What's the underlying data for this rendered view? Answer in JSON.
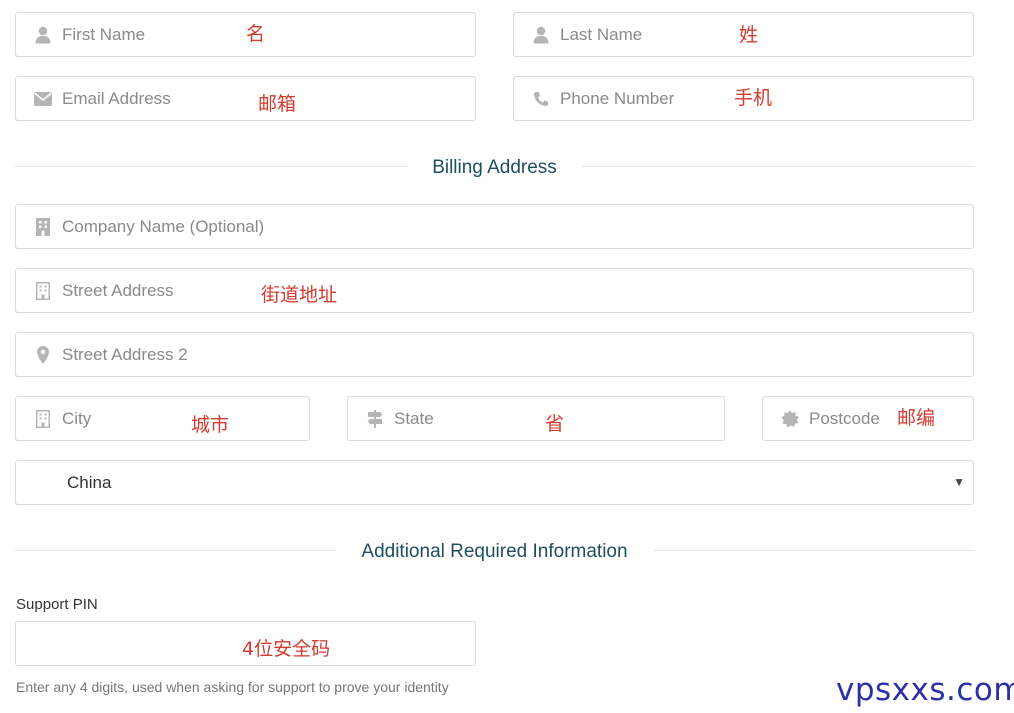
{
  "contact": {
    "first_name": {
      "placeholder": "First Name",
      "note": "名"
    },
    "last_name": {
      "placeholder": "Last Name",
      "note": "姓"
    },
    "email": {
      "placeholder": "Email Address",
      "note": "邮箱"
    },
    "phone": {
      "placeholder": "Phone Number",
      "note": "手机"
    }
  },
  "billing": {
    "title": "Billing Address",
    "company": {
      "placeholder": "Company Name (Optional)"
    },
    "street": {
      "placeholder": "Street Address",
      "note": "街道地址"
    },
    "street2": {
      "placeholder": "Street Address 2"
    },
    "city": {
      "placeholder": "City",
      "note": "城市"
    },
    "state": {
      "placeholder": "State",
      "note": "省"
    },
    "postcode": {
      "placeholder": "Postcode",
      "note": "邮编"
    },
    "country": {
      "value": "China"
    }
  },
  "additional": {
    "title": "Additional Required Information",
    "support_pin_label": "Support PIN",
    "support_pin_note": "4位安全码",
    "support_pin_help": "Enter any 4 digits, used when asking for support to prove your identity"
  },
  "watermark": "vpsxxs.com",
  "colors": {
    "note": "#d23b2f",
    "section_title": "#1f4e5e",
    "watermark": "#2c2fa8",
    "icon": "#b5b5b5",
    "border": "#d9d9d9"
  }
}
